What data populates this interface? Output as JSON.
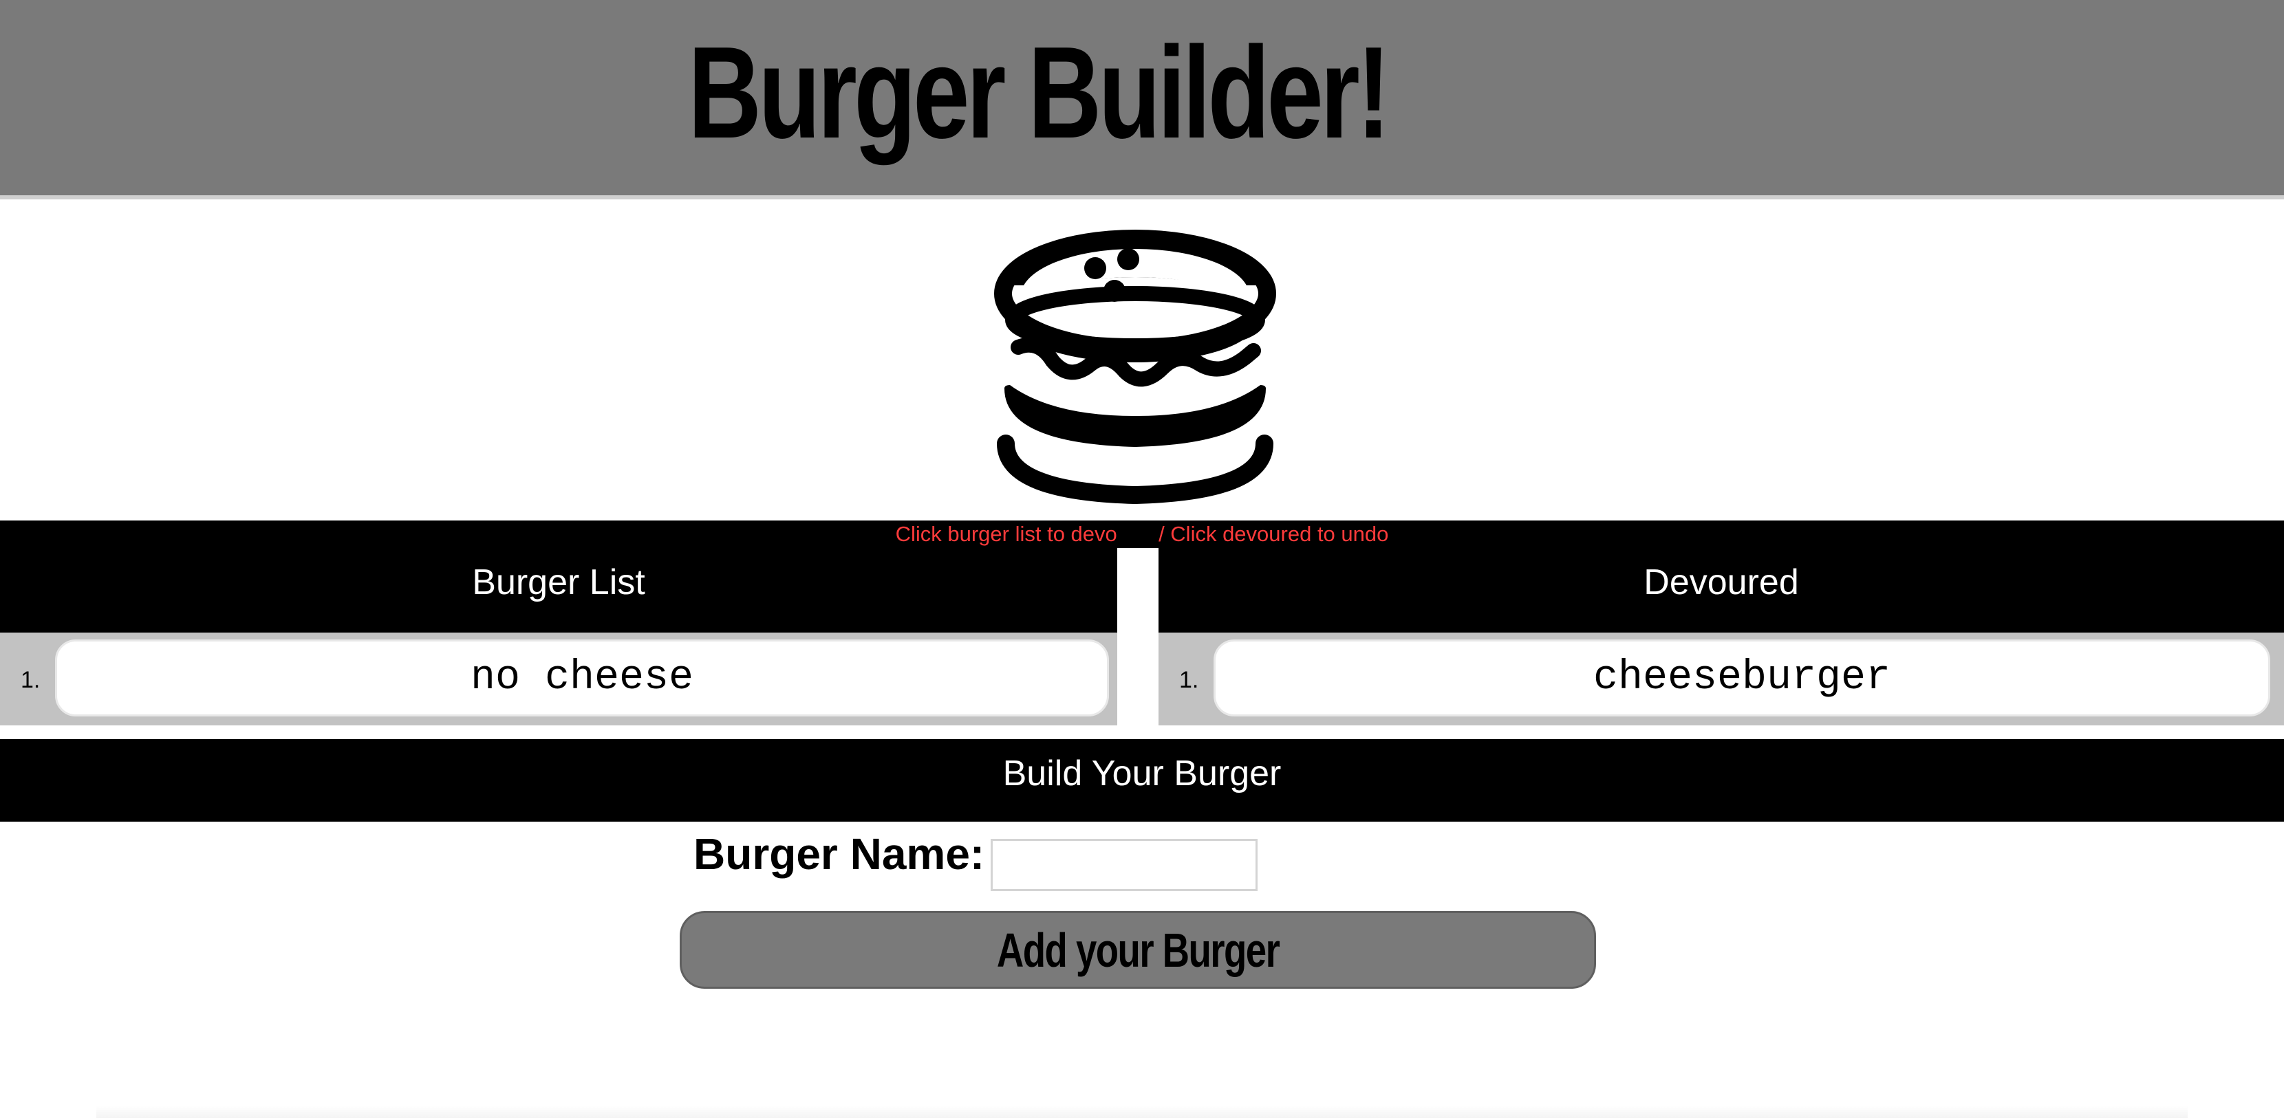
{
  "header": {
    "title": "Burger Builder!"
  },
  "logo": {
    "icon": "burger-icon"
  },
  "instructions": "Click burger list to devour it / Click devoured to undo",
  "burger_list": {
    "heading": "Burger List",
    "items": [
      {
        "number": "1.",
        "name": "no cheese"
      }
    ]
  },
  "devoured": {
    "heading": "Devoured",
    "items": [
      {
        "number": "1.",
        "name": "cheeseburger"
      }
    ]
  },
  "build": {
    "heading": "Build Your Burger",
    "name_label": "Burger Name:",
    "name_value": "",
    "name_placeholder": "",
    "submit_label": "Add your Burger"
  },
  "colors": {
    "header_bg": "#7a7a7a",
    "hint_text": "#ff3b3b",
    "section_bg": "#000000",
    "list_bg": "#c2c2c2"
  }
}
